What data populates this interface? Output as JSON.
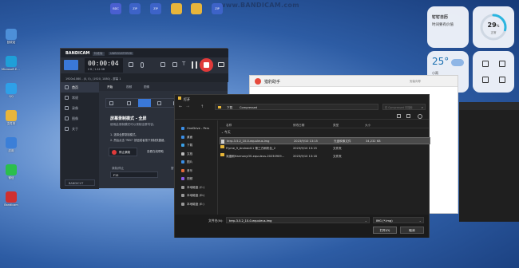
{
  "watermark": "www.BANDICAM.com",
  "desktop": {
    "left_icons": [
      {
        "name": "recycle-bin",
        "label": "回收站",
        "color": "#4d8fd8"
      },
      {
        "name": "edge",
        "label": "Microsoft Edge",
        "color": "#1f9fd8"
      },
      {
        "name": "qq",
        "label": "QQ",
        "color": "#2ea0e8"
      },
      {
        "name": "folder",
        "label": "文件夹",
        "color": "#e8b53b"
      },
      {
        "name": "app-store",
        "label": "应用",
        "color": "#3b7fd8"
      },
      {
        "name": "wechat",
        "label": "微信",
        "color": "#2bbf4c"
      },
      {
        "name": "bandicam",
        "label": "Bandicam",
        "color": "#d03030"
      }
    ],
    "top_icons": [
      {
        "name": "bdc",
        "label": "BDC",
        "color": "#4a5fd0"
      },
      {
        "name": "zip-1",
        "label": "ZIP",
        "color": "#3d63c8"
      },
      {
        "name": "zip-2",
        "label": "ZIP",
        "color": "#3d63c8"
      },
      {
        "name": "folder-a",
        "label": "",
        "color": "#e8b53b"
      },
      {
        "name": "folder-b",
        "label": "",
        "color": "#e8b53b"
      },
      {
        "name": "zip-3",
        "label": "ZIP",
        "color": "#3d63c8"
      }
    ]
  },
  "widgets": {
    "calendar_line1": "钉钉日历",
    "calendar_line2": "时间要有价值",
    "battery_value": "29",
    "battery_unit": "%",
    "battery_status": "正常",
    "weather_temp": "25°",
    "weather_desc": "小雨"
  },
  "bandicam": {
    "brand": "BANDICAM",
    "title_tag1": "标准版",
    "title_tag2": "UNREGISTERED",
    "timer": "00:00:04",
    "size": "0 B / 1.44 GB",
    "resolution": "1920x1080 - (0, 0), (1920, 1080) - 屏幕 1",
    "nav": [
      "首页",
      "常规",
      "录像",
      "图像",
      "关于"
    ],
    "tabs": [
      "开始",
      "视频",
      "图像"
    ],
    "mode_title": "屏幕录制模式 - 全屏",
    "mode_desc": "使用此录制模式可以录制全屏内容。",
    "step1": "1. 选择全屏录制模式。",
    "step2": "2. 然后点击 \"REC\" 按钮或者按下录制快捷键。",
    "rec_button": "停止录制",
    "help_link": "查看在线帮助",
    "hotkey_label": "录制/停止",
    "hotkey_value": "F12",
    "hotkey_label2": "暂停",
    "footer": "BANDICUT"
  },
  "browser": {
    "tab_title": "猎豹助手",
    "tab_extra": "安装向导"
  },
  "dialog": {
    "title": "打开",
    "path_parts": [
      "下载",
      "Compressed"
    ],
    "search_placeholder": "在 Compressed 中搜索",
    "columns": [
      "名称",
      "修改日期",
      "类型",
      "大小"
    ],
    "group": "今天",
    "files": [
      {
        "name": "terp-3.5.2_10-0-equuleus.img",
        "date": "2023/9/10 13:15",
        "type": "光盘映像文件",
        "size": "34,232 KB",
        "folder": false,
        "selected": true
      },
      {
        "name": "Flyme_9_Android11 第三方刷机包_2",
        "date": "2023/9/10 13:15",
        "type": "文件夹",
        "size": "",
        "folder": true,
        "selected": false
      },
      {
        "name": "深度刷HarmonyOS-equuleus-20230909...",
        "date": "2023/9/10 13:18",
        "type": "文件夹",
        "size": "",
        "folder": true,
        "selected": false
      }
    ],
    "sidebar": [
      {
        "name": "OneDrive - Pers",
        "color": "#3a8ee6"
      },
      {
        "name": "桌面",
        "color": "#3a8ee6"
      },
      {
        "name": "下载",
        "color": "#3aa0e6"
      },
      {
        "name": "文档",
        "color": "#bbbbbb"
      },
      {
        "name": "图片",
        "color": "#3a8ee6"
      },
      {
        "name": "音乐",
        "color": "#e26a3a"
      },
      {
        "name": "视频",
        "color": "#8a5ae6"
      },
      {
        "name": "本地磁盘 (C:)",
        "color": "#9a9a9a"
      },
      {
        "name": "本地磁盘 (D:)",
        "color": "#9a9a9a"
      },
      {
        "name": "本地磁盘 (E:)",
        "color": "#9a9a9a"
      }
    ],
    "filename_label": "文件名(N):",
    "filename_value": "terp-3.5.2_10-0-equuleus.img",
    "filetype_value": "IMG (*.img)",
    "open_button": "打开(O)",
    "cancel_button": "取消"
  }
}
